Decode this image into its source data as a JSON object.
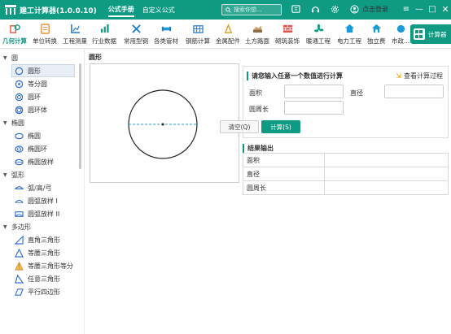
{
  "app": {
    "title": "建工计算器(1.0.0.10)",
    "tabs": [
      {
        "label": "公式手册",
        "active": true
      },
      {
        "label": "自定义公式",
        "active": false
      }
    ],
    "search_placeholder": "搜索你想...",
    "login_label": "点击登录",
    "accent_color": "#0e9a83"
  },
  "toolbar": {
    "items": [
      {
        "label": "几何计算",
        "icon": "geometry-icon",
        "active": true
      },
      {
        "label": "单位转换",
        "icon": "unit-convert-icon"
      },
      {
        "label": "工程测量",
        "icon": "survey-icon"
      },
      {
        "label": "行业数据",
        "icon": "industry-data-icon"
      },
      {
        "label": "常用型钢",
        "icon": "steel-icon"
      },
      {
        "label": "各类管材",
        "icon": "pipe-icon"
      },
      {
        "label": "钢筋计算",
        "icon": "rebar-icon"
      },
      {
        "label": "金属配件",
        "icon": "metal-parts-icon"
      },
      {
        "label": "土方路面",
        "icon": "earthwork-icon"
      },
      {
        "label": "砌筑装饰",
        "icon": "masonry-icon"
      },
      {
        "label": "暖通工程",
        "icon": "hvac-icon"
      },
      {
        "label": "电力工程",
        "icon": "power-icon"
      },
      {
        "label": "独立费",
        "icon": "fee-icon"
      },
      {
        "label": "市政...",
        "icon": "municipal-icon"
      }
    ],
    "calc_button_label": "计算器"
  },
  "sidebar": {
    "groups": [
      {
        "label": "圆",
        "items": [
          {
            "label": "圆形",
            "icon": "circle-icon",
            "active": true
          },
          {
            "label": "等分圆",
            "icon": "divided-circle-icon"
          },
          {
            "label": "圆环",
            "icon": "ring-icon"
          },
          {
            "label": "圆环体",
            "icon": "torus-icon"
          }
        ]
      },
      {
        "label": "椭圆",
        "items": [
          {
            "label": "椭圆",
            "icon": "ellipse-icon"
          },
          {
            "label": "椭圆环",
            "icon": "ellipse-ring-icon"
          },
          {
            "label": "椭圆放样",
            "icon": "ellipse-lofting-icon"
          }
        ]
      },
      {
        "label": "弧形",
        "items": [
          {
            "label": "弧/高/弓",
            "icon": "arc-icon"
          },
          {
            "label": "圆弧放样 I",
            "icon": "arc-lofting-1-icon"
          },
          {
            "label": "圆弧放样 II",
            "icon": "arc-lofting-2-icon"
          }
        ]
      },
      {
        "label": "多边形",
        "items": [
          {
            "label": "直角三角形",
            "icon": "right-triangle-icon"
          },
          {
            "label": "等腰三角形",
            "icon": "isosceles-triangle-icon"
          },
          {
            "label": "等腰三角形等分",
            "icon": "isosceles-divided-icon"
          },
          {
            "label": "任意三角形",
            "icon": "any-triangle-icon"
          },
          {
            "label": "平行四边形",
            "icon": "parallelogram-icon"
          }
        ]
      }
    ]
  },
  "main": {
    "title": "圆形",
    "input_panel": {
      "heading": "请您输入任意一个数值进行计算",
      "view_process": "查看计算过程",
      "fields": [
        {
          "label": "面积",
          "value": ""
        },
        {
          "label": "直径",
          "value": ""
        },
        {
          "label": "圆周长",
          "value": ""
        }
      ],
      "clear_label": "清空(Q)",
      "calc_label": "计算(S)"
    },
    "result": {
      "heading": "结果输出",
      "rows": [
        {
          "label": "面积",
          "value": ""
        },
        {
          "label": "直径",
          "value": ""
        },
        {
          "label": "圆周长",
          "value": ""
        }
      ]
    }
  }
}
